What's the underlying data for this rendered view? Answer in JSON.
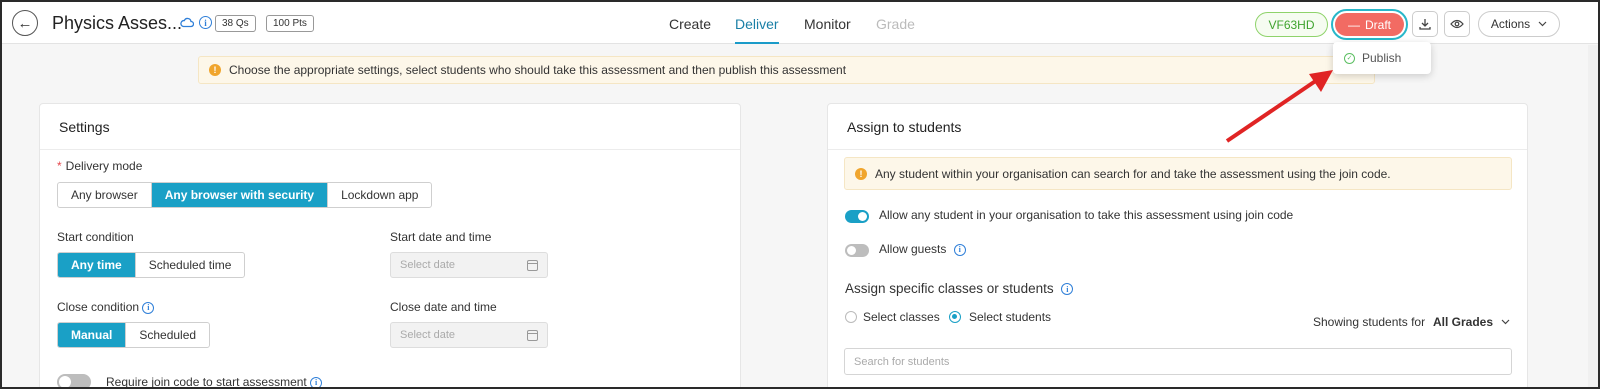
{
  "header": {
    "back_icon": "arrow-left-icon",
    "title": "Physics Asses...",
    "questions_badge": "38 Qs",
    "points_badge": "100 Pts",
    "tabs": [
      {
        "label": "Create",
        "state": "normal"
      },
      {
        "label": "Deliver",
        "state": "active"
      },
      {
        "label": "Monitor",
        "state": "normal"
      },
      {
        "label": "Grade",
        "state": "disabled"
      }
    ],
    "join_code": "VF63HD",
    "status_button": "Draft",
    "actions_label": "Actions"
  },
  "status_menu": {
    "publish_label": "Publish"
  },
  "banner": {
    "text": "Choose the appropriate settings, select students who should take this assessment and then publish this assessment"
  },
  "settings": {
    "title": "Settings",
    "delivery_mode": {
      "label": "Delivery mode",
      "options": [
        "Any browser",
        "Any browser with security",
        "Lockdown app"
      ],
      "selected": "Any browser with security"
    },
    "start_condition": {
      "label": "Start condition",
      "options": [
        "Any time",
        "Scheduled time"
      ],
      "selected": "Any time"
    },
    "start_datetime": {
      "label": "Start date and time",
      "placeholder": "Select date"
    },
    "close_condition": {
      "label": "Close condition",
      "options": [
        "Manual",
        "Scheduled"
      ],
      "selected": "Manual"
    },
    "close_datetime": {
      "label": "Close date and time",
      "placeholder": "Select date"
    },
    "join_code_toggle": {
      "label": "Require join code to start assessment",
      "on": false
    }
  },
  "assign": {
    "title": "Assign to students",
    "notice": "Any student within your organisation can search for and take the assessment using the join code.",
    "allow_join_code": {
      "label": "Allow any student in your organisation to take this assessment using join code",
      "on": true
    },
    "allow_guests": {
      "label": "Allow guests",
      "on": false
    },
    "specific_heading": "Assign specific classes or students",
    "radio_options": [
      "Select classes",
      "Select students"
    ],
    "radio_selected": "Select students",
    "showing_label": "Showing students for",
    "grade_filter": "All Grades",
    "search_placeholder": "Search for students"
  },
  "colors": {
    "accent": "#1aa0c6",
    "draft": "#f26b63",
    "join_code": "#3fa32e",
    "annotation_arrow": "#e02424"
  }
}
